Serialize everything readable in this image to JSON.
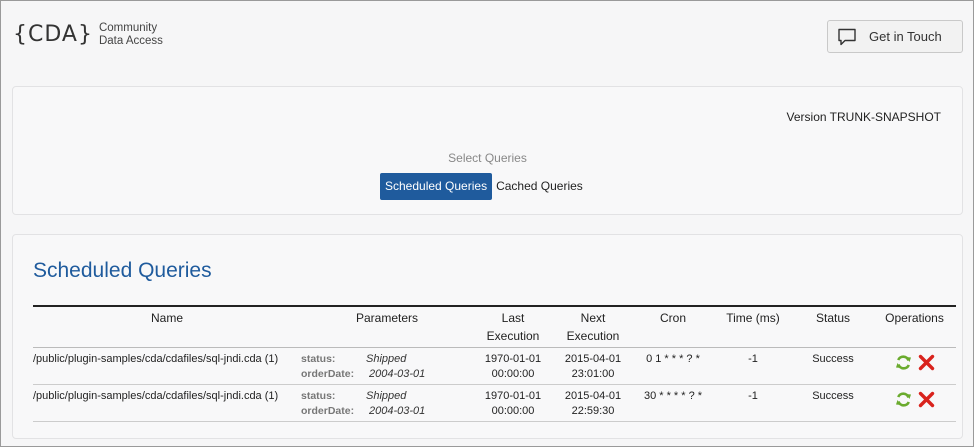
{
  "header": {
    "logo_mark": "{CDA}",
    "logo_line1": "Community",
    "logo_line2": "Data Access",
    "contact_button": "Get in Touch"
  },
  "top_panel": {
    "version": "Version TRUNK-SNAPSHOT",
    "select_label": "Select Queries",
    "tabs": [
      {
        "label": "Scheduled Queries",
        "active": true
      },
      {
        "label": "Cached Queries",
        "active": false
      }
    ]
  },
  "scheduled": {
    "title": "Scheduled Queries",
    "columns": {
      "name": "Name",
      "parameters": "Parameters",
      "last_1": "Last",
      "last_2": "Execution",
      "next_1": "Next",
      "next_2": "Execution",
      "cron": "Cron",
      "time": "Time (ms)",
      "status": "Status",
      "operations": "Operations"
    },
    "rows": [
      {
        "name": "/public/plugin-samples/cda/cdafiles/sql-jndi.cda (1)",
        "param_status_key": "status:",
        "param_status_val": "Shipped",
        "param_date_key": "orderDate:",
        "param_date_val": "2004-03-01",
        "last_date": "1970-01-01",
        "last_time": "00:00:00",
        "next_date": "2015-04-01",
        "next_time": "23:01:00",
        "cron": "0 1 * * * ? *",
        "time_ms": "-1",
        "status": "Success"
      },
      {
        "name": "/public/plugin-samples/cda/cdafiles/sql-jndi.cda (1)",
        "param_status_key": "status:",
        "param_status_val": "Shipped",
        "param_date_key": "orderDate:",
        "param_date_val": "2004-03-01",
        "last_date": "1970-01-01",
        "last_time": "00:00:00",
        "next_date": "2015-04-01",
        "next_time": "22:59:30",
        "cron": "30 * * * * ? *",
        "time_ms": "-1",
        "status": "Success"
      }
    ]
  },
  "icons": {
    "chat": "chat-bubble-icon",
    "refresh": "refresh-icon",
    "delete": "delete-icon"
  },
  "colors": {
    "accent": "#1f5b9d",
    "refresh": "#6aab2e",
    "delete": "#d9231d"
  }
}
